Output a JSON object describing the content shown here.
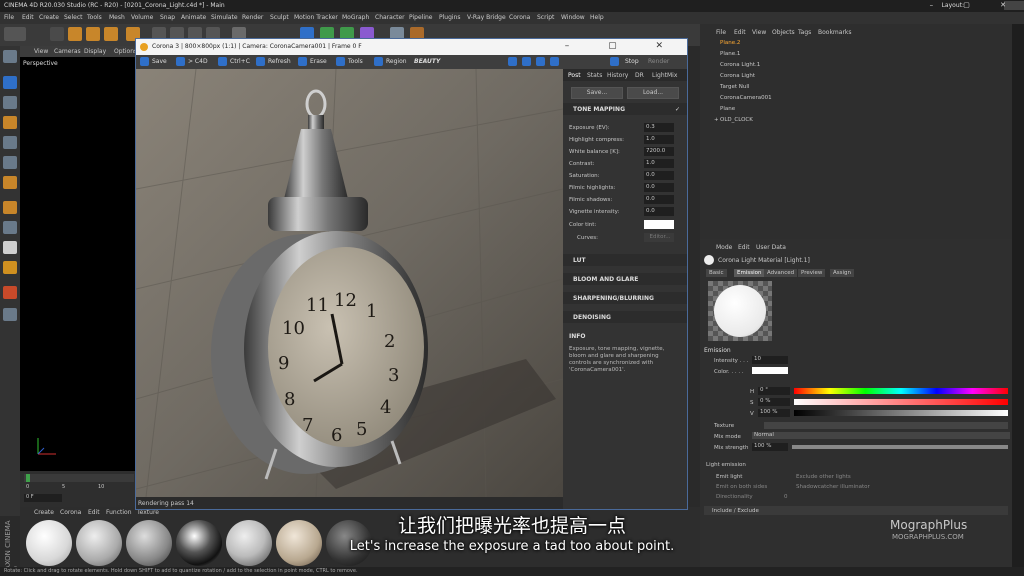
{
  "app": {
    "title": "CINEMA 4D R20.030 Studio (RC - R20) - [0201_Corona_Light.c4d *] - Main",
    "layout_label": "Layout:",
    "layout_value": "Startup (User)"
  },
  "menu": [
    "File",
    "Edit",
    "Create",
    "Select",
    "Tools",
    "Mesh",
    "Volume",
    "Snap",
    "Animate",
    "Simulate",
    "Render",
    "Sculpt",
    "Motion Tracker",
    "MoGraph",
    "Character",
    "Pipeline",
    "Plugins",
    "V-Ray Bridge",
    "Corona",
    "Script",
    "Window",
    "Help"
  ],
  "viewport": {
    "menu": [
      "View",
      "Cameras",
      "Display",
      "Options"
    ],
    "label": "Perspective"
  },
  "timeline": {
    "ticks": [
      "0",
      "5",
      "10"
    ],
    "frame": "0 F"
  },
  "vfb": {
    "title": "Corona 3 | 800×800px (1:1) | Camera: CoronaCamera001 | Frame 0 F",
    "toolbar": {
      "save": "Save",
      "c4d": "> C4D",
      "ctrlc": "Ctrl+C",
      "refresh": "Refresh",
      "erase": "Erase",
      "tools": "Tools",
      "region": "Region",
      "channel": "BEAUTY",
      "stop": "Stop",
      "render": "Render"
    },
    "status": "Rendering pass 14",
    "post": {
      "tabs": [
        "Post",
        "Stats",
        "History",
        "DR",
        "LightMix"
      ],
      "save_btn": "Save...",
      "load_btn": "Load...",
      "tone_mapping": "TONE MAPPING",
      "params": [
        {
          "label": "Exposure (EV):",
          "value": "0.3"
        },
        {
          "label": "Highlight compress:",
          "value": "1.0"
        },
        {
          "label": "White balance [K]:",
          "value": "7200.0"
        },
        {
          "label": "Contrast:",
          "value": "1.0"
        },
        {
          "label": "Saturation:",
          "value": "0.0"
        },
        {
          "label": "Filmic highlights:",
          "value": "0.0"
        },
        {
          "label": "Filmic shadows:",
          "value": "0.0"
        },
        {
          "label": "Vignette intensity:",
          "value": "0.0"
        }
      ],
      "color_tint": "Color tint:",
      "curves": "Curves:",
      "curves_btn": "Editor...",
      "sections": [
        "LUT",
        "BLOOM AND GLARE",
        "SHARPENING/BLURRING",
        "DENOISING"
      ],
      "info_title": "INFO",
      "info_text": "Exposure, tone mapping, vignette, bloom and glare and sharpening controls are synchronized with 'CoronaCamera001'."
    }
  },
  "objects": {
    "menu": [
      "File",
      "Edit",
      "View",
      "Objects",
      "Tags",
      "Bookmarks"
    ],
    "rows": [
      "Plane.2",
      "Plane.1",
      "Corona Light.1",
      "Corona Light",
      "Target Null",
      "CoronaCamera001",
      "Plane",
      "OLD_CLOCK"
    ]
  },
  "attributes": {
    "menu": [
      "Mode",
      "Edit",
      "User Data"
    ],
    "object_title": "Corona Light Material [Light.1]",
    "tabs": [
      "Basic",
      "Emission",
      "Advanced",
      "Preview",
      "Assign"
    ],
    "emission_label": "Emission",
    "intensity_label": "Intensity . . .",
    "intensity_value": "10",
    "color_label": "Color. . . . .",
    "h_label": "H",
    "h_value": "0 °",
    "s_label": "S",
    "s_value": "0 %",
    "v_label": "V",
    "v_value": "100 %",
    "texture_label": "Texture",
    "mixmode_label": "Mix mode",
    "mixmode_value": "Normal",
    "mixstrength_label": "Mix strength",
    "mixstrength_value": "100 %",
    "light_emission_label": "Light emission",
    "emit_light": "Emit light",
    "emit_both": "Emit on both sides",
    "directionality": "Directionality",
    "directionality_value": "0",
    "exclude_lights": "Exclude other lights",
    "shadowcatcher": "Shadowcatcher illuminator",
    "include_exclude": "Include / Exclude"
  },
  "materials": {
    "menu": [
      "Create",
      "Corona",
      "Edit",
      "Function",
      "Texture"
    ]
  },
  "status_bar": "Rotate: Click and drag to rotate elements. Hold down SHIFT to add to quantize rotation / add to the selection in point mode, CTRL to remove.",
  "subtitle": {
    "cn": "让我们把曝光率也提高一点",
    "en": "Let's increase the exposure a tad too about point."
  },
  "brand": {
    "name": "MographPlus",
    "url": "MOGRAPHPLUS.COM"
  },
  "vertical_brand": "MAXON CINEMA 4D",
  "colors": {
    "accent": "#2f6fc8",
    "selected": "#ffaa33",
    "panel": "#333333"
  }
}
